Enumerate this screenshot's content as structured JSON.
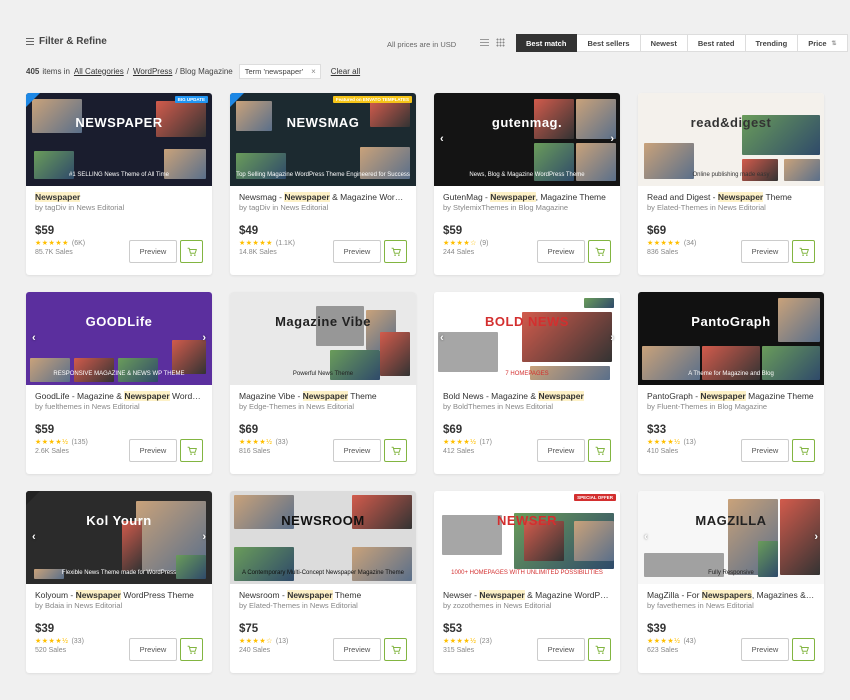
{
  "toolbar": {
    "filter_label": "Filter & Refine",
    "price_note": "All prices are in USD",
    "sort_tabs": [
      {
        "label": "Best match",
        "active": true
      },
      {
        "label": "Best sellers",
        "active": false
      },
      {
        "label": "Newest",
        "active": false
      },
      {
        "label": "Best rated",
        "active": false
      },
      {
        "label": "Trending",
        "active": false
      },
      {
        "label": "Price",
        "active": false
      }
    ]
  },
  "breadcrumb": {
    "count": "405",
    "count_suffix": "items in",
    "cat1": "All Categories",
    "sep1": "/",
    "cat2": "WordPress",
    "cat3": "/ Blog Magazine",
    "term": "Term 'newspaper'",
    "remove": "×",
    "clear": "Clear all"
  },
  "items": [
    {
      "thumb": {
        "title": "NEWSPAPER",
        "sub": "#1 SELLING News Theme of All Time",
        "badge": "BIG UPDATE",
        "bg": "#1a1d2e",
        "color": "#ffffff",
        "accent": "#2196f3"
      },
      "title_pre": "",
      "title_hl": "Newspaper",
      "title_post": "",
      "author": "tagDiv",
      "category": "News Editorial",
      "price": "$59",
      "stars": "★★★★★",
      "reviews": "(6K)",
      "sales": "85.7K Sales"
    },
    {
      "thumb": {
        "title": "NEWSMAG",
        "sub": "Top Selling Magazine WordPress Theme Engineered for Success",
        "badge": "Featured on ENVATO TEMPLATES",
        "bg": "#1c2a30",
        "color": "#ffffff",
        "accent": "#f5c518"
      },
      "title_pre": "Newsmag - ",
      "title_hl": "Newspaper",
      "title_post": " & Magazine WordPress Theme",
      "author": "tagDiv",
      "category": "News Editorial",
      "price": "$49",
      "stars": "★★★★★",
      "reviews": "(1.1K)",
      "sales": "14.8K Sales"
    },
    {
      "thumb": {
        "title": "gutenmag.",
        "sub": "News, Blog & Magazine WordPress Theme",
        "badge": "",
        "bg": "#141414",
        "color": "#ffffff",
        "accent": "#e53935"
      },
      "title_pre": "GutenMag - ",
      "title_hl": "Newspaper",
      "title_post": ", Magazine Theme",
      "author": "StylemixThemes",
      "category": "Blog Magazine",
      "price": "$59",
      "stars": "★★★★☆",
      "reviews": "(9)",
      "sales": "244 Sales"
    },
    {
      "thumb": {
        "title": "read&digest",
        "sub": "Online publishing made easy",
        "badge": "",
        "bg": "#f4f1ec",
        "color": "#333333",
        "accent": "#777777"
      },
      "title_pre": "Read and Digest - ",
      "title_hl": "Newspaper",
      "title_post": " Theme",
      "author": "Elated-Themes",
      "category": "News Editorial",
      "price": "$69",
      "stars": "★★★★★",
      "reviews": "(34)",
      "sales": "836 Sales"
    },
    {
      "thumb": {
        "title": "GOODLife",
        "sub": "RESPONSIVE MAGAZINE & NEWS WP THEME",
        "badge": "",
        "bg": "#5b2f9e",
        "color": "#ffffff",
        "accent": "#e91e63"
      },
      "title_pre": "GoodLife - Magazine & ",
      "title_hl": "Newspaper",
      "title_post": " WordPress Theme",
      "author": "fuelthemes",
      "category": "News Editorial",
      "price": "$59",
      "stars": "★★★★½",
      "reviews": "(135)",
      "sales": "2.6K Sales"
    },
    {
      "thumb": {
        "title": "Magazine Vibe",
        "sub": "Powerful News Theme",
        "badge": "",
        "bg": "#e9e9e9",
        "color": "#222222",
        "accent": "#555555"
      },
      "title_pre": "Magazine Vibe - ",
      "title_hl": "Newspaper",
      "title_post": " Theme",
      "author": "Edge-Themes",
      "category": "News Editorial",
      "price": "$69",
      "stars": "★★★★½",
      "reviews": "(33)",
      "sales": "816 Sales"
    },
    {
      "thumb": {
        "title": "BOLD NEWS",
        "sub": "7 HOMEPAGES",
        "badge": "",
        "bg": "#ffffff",
        "color": "#d32f2f",
        "accent": "#d32f2f"
      },
      "title_pre": "Bold News - Magazine & ",
      "title_hl": "Newspaper",
      "title_post": "",
      "author": "BoldThemes",
      "category": "News Editorial",
      "price": "$69",
      "stars": "★★★★½",
      "reviews": "(17)",
      "sales": "412 Sales"
    },
    {
      "thumb": {
        "title": "PantoGraph",
        "sub": "A Theme for Magazine and Blog",
        "badge": "",
        "bg": "#111111",
        "color": "#ffffff",
        "accent": "#ff5722"
      },
      "title_pre": "PantoGraph - ",
      "title_hl": "Newspaper",
      "title_post": " Magazine Theme",
      "author": "Fluent-Themes",
      "category": "Blog Magazine",
      "price": "$33",
      "stars": "★★★★½",
      "reviews": "(13)",
      "sales": "410 Sales"
    },
    {
      "thumb": {
        "title": "Kol Yourn",
        "sub": "Flexible News Theme made for WordPress",
        "badge": "",
        "bg": "#2b2b2b",
        "color": "#ffffff",
        "accent": "#e53935"
      },
      "title_pre": "Kolyoum - ",
      "title_hl": "Newspaper",
      "title_post": " WordPress Theme",
      "author": "Bdaia",
      "category": "News Editorial",
      "price": "$39",
      "stars": "★★★★½",
      "reviews": "(33)",
      "sales": "520 Sales"
    },
    {
      "thumb": {
        "title": "NEWSROOM",
        "sub": "A Contemporary Multi-Concept Newspaper Magazine Theme",
        "badge": "",
        "bg": "#dcdcdc",
        "color": "#111111",
        "accent": "#111111"
      },
      "title_pre": "Newsroom - ",
      "title_hl": "Newspaper",
      "title_post": " Theme",
      "author": "Elated-Themes",
      "category": "News Editorial",
      "price": "$75",
      "stars": "★★★★☆",
      "reviews": "(13)",
      "sales": "240 Sales"
    },
    {
      "thumb": {
        "title": "NEWSER",
        "sub": "1000+ HOMEPAGES WITH UNLIMITED POSSIBILITIES",
        "badge": "SPECIAL OFFER",
        "bg": "#ffffff",
        "color": "#d32f2f",
        "accent": "#d32f2f"
      },
      "title_pre": "Newser - ",
      "title_hl": "Newspaper",
      "title_post": " & Magazine WordPress Theme",
      "author": "zozothemes",
      "category": "News Editorial",
      "price": "$53",
      "stars": "★★★★½",
      "reviews": "(23)",
      "sales": "315 Sales"
    },
    {
      "thumb": {
        "title": "MAGZILLA",
        "sub": "Fully Responsive",
        "badge": "",
        "bg": "#f7f7f7",
        "color": "#222222",
        "accent": "#1e88e5"
      },
      "title_pre": "MagZilla - For ",
      "title_hl": "Newspapers",
      "title_post": ", Magazines & Blogs",
      "author": "favethemes",
      "category": "News Editorial",
      "price": "$39",
      "stars": "★★★★½",
      "reviews": "(43)",
      "sales": "623 Sales"
    }
  ],
  "labels": {
    "preview": "Preview",
    "by": "by",
    "in": "in"
  },
  "colors": {
    "highlight": "#fdf1c7",
    "star": "#ffbf00",
    "cart_green": "#82b541",
    "active_tab": "#333333"
  }
}
